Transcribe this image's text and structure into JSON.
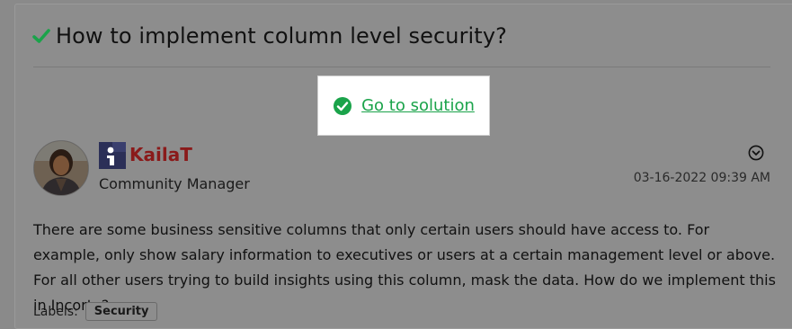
{
  "post": {
    "title": "How to implement column level security?",
    "solution_link": "Go to solution",
    "author": {
      "username": "KailaT",
      "rank": "Community Manager"
    },
    "datetime": "03-16-2022 09:39 AM",
    "body": "There are some business sensitive columns that only certain users should have access to.   For example, only show salary information to executives or users at a certain management level or above. For all other users trying to build insights using this column, mask the data. How do we implement this in Incorta?",
    "labels_caption": "Labels:",
    "labels": [
      "Security"
    ]
  },
  "colors": {
    "accent_green": "#1aa34a",
    "username_red": "#8a1a1a",
    "overlay_gray": "#8a8a8a"
  },
  "icons": {
    "title_icon": "checkmark-icon",
    "solution_icon": "check-circle-icon",
    "rank_icon": "community-rank-icon",
    "options_icon": "chevron-down-circle-icon"
  }
}
